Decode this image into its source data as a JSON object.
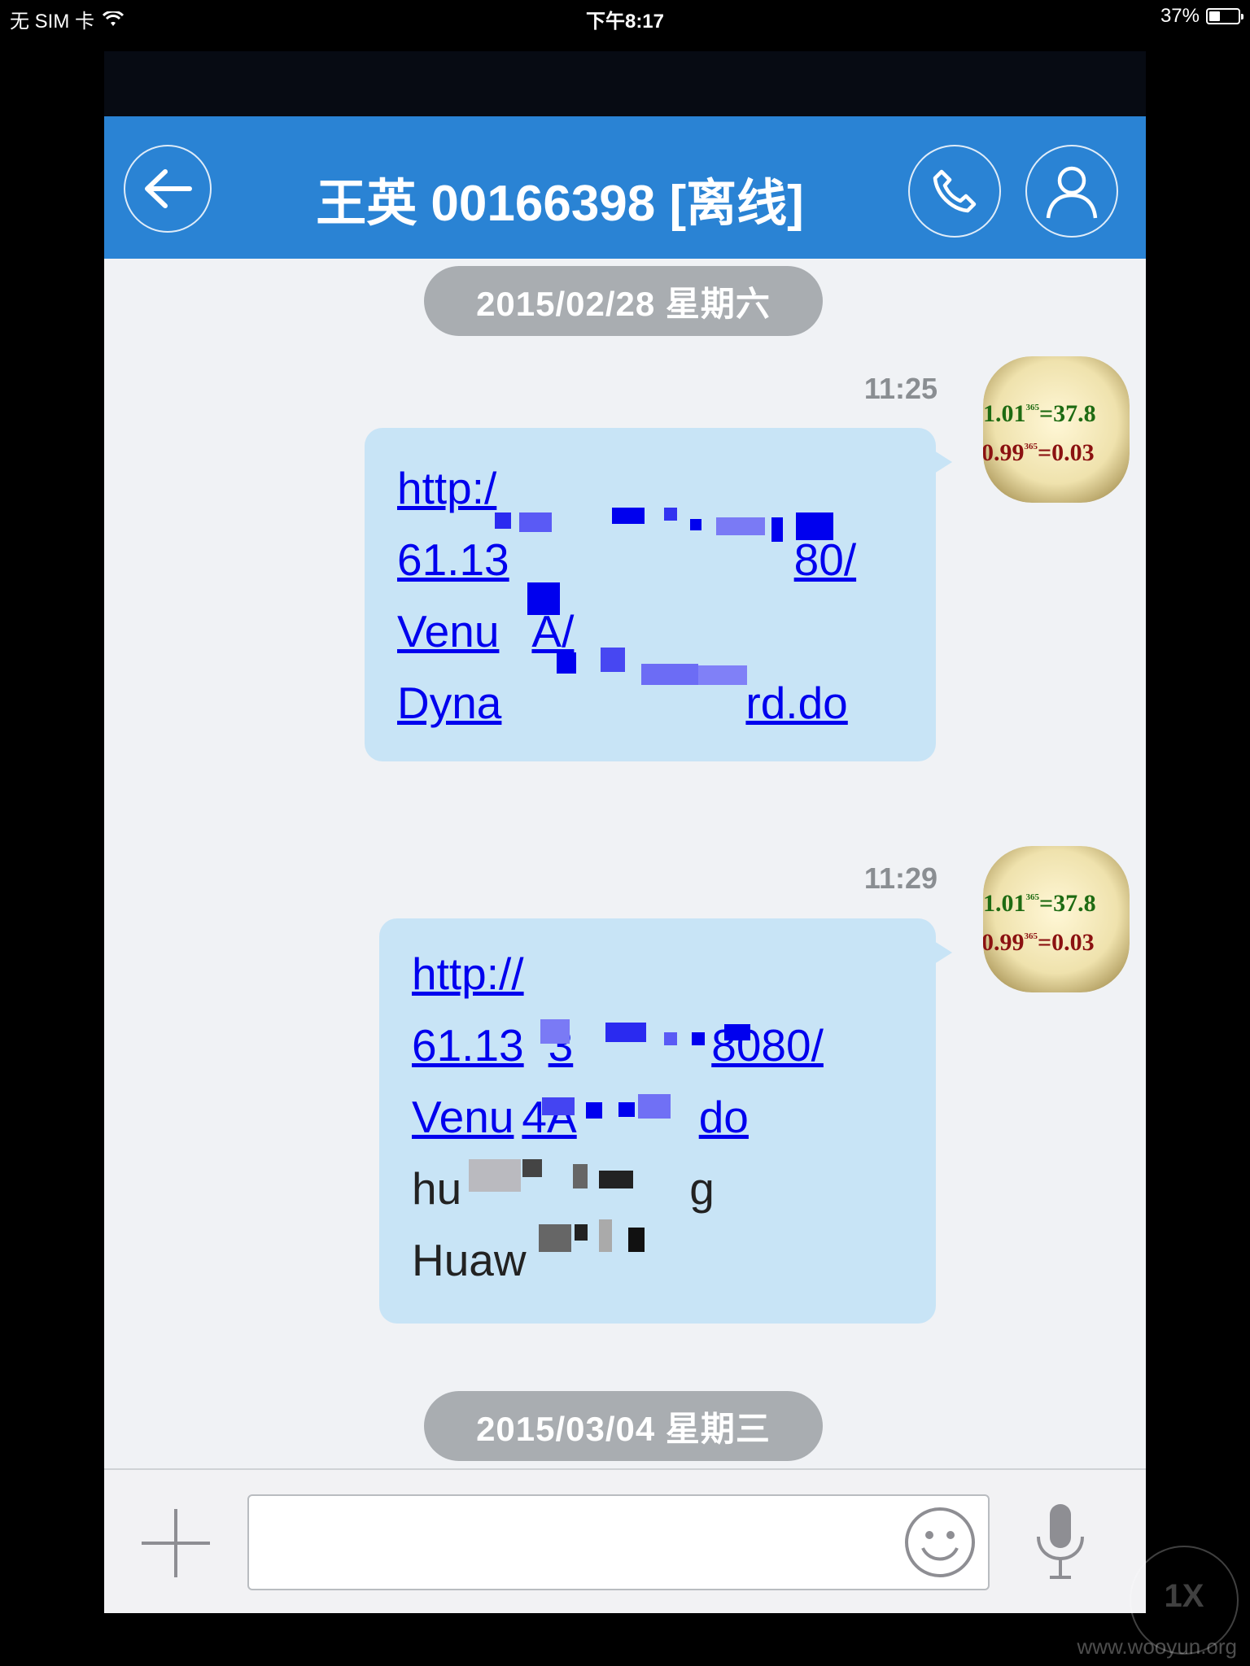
{
  "status_bar": {
    "carrier": "无 SIM 卡",
    "time": "下午8:17",
    "battery_text": "37%",
    "battery_level": 0.37
  },
  "chat": {
    "title": "王英 00166398 [离线]",
    "back_icon": "back-arrow-icon",
    "call_icon": "phone-icon",
    "profile_icon": "user-icon"
  },
  "date_separators": [
    "2015/02/28 星期六",
    "2015/03/04 星期三"
  ],
  "messages": [
    {
      "time": "11:25",
      "avatar_text": [
        "1.01",
        "365",
        "=37.8",
        "0.99",
        "365",
        "=0.03"
      ],
      "lines": [
        "http:/",
        "61.13",
        "80/",
        "Venu",
        "A/",
        "Dyna",
        "rd.do"
      ]
    },
    {
      "time": "11:29",
      "lines": [
        "http://",
        "61.13",
        "3",
        "8080/",
        "Venu",
        "4A",
        "do",
        "hu",
        "g",
        "Huaw"
      ]
    }
  ],
  "input": {
    "placeholder": "",
    "add_icon": "plus-icon",
    "emoji_icon": "smiley-icon",
    "voice_icon": "microphone-icon"
  },
  "watermark": {
    "badge": "1X",
    "site": "www.wooyun.org"
  }
}
